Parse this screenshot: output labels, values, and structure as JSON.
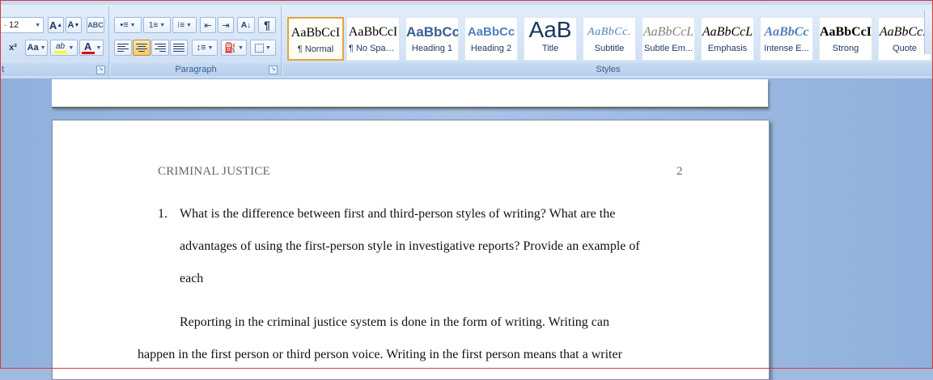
{
  "ribbon": {
    "font_group": {
      "label": "t",
      "font_size": "12",
      "grow_label": "A",
      "shrink_label": "A",
      "superscript_label": "x²",
      "change_case_label": "Aa",
      "highlight_label": "ab",
      "font_color_label": "A",
      "highlight_color": "#ffff00",
      "font_color": "#e00000"
    },
    "paragraph_group": {
      "label": "Paragraph",
      "sort_label": "A↓",
      "show_marks_label": "¶"
    },
    "styles_group": {
      "label": "Styles",
      "styles": [
        {
          "sample": "AaBbCcI",
          "name": "¶ Normal",
          "selected": true
        },
        {
          "sample": "AaBbCcI",
          "name": "¶ No Spaci..."
        },
        {
          "sample": "AaBbCс",
          "name": "Heading 1"
        },
        {
          "sample": "AaBbCc",
          "name": "Heading 2"
        },
        {
          "sample": "AaB",
          "name": "Title"
        },
        {
          "sample": "AaBbCc.",
          "name": "Subtitle"
        },
        {
          "sample": "AaBbCcL",
          "name": "Subtle Em..."
        },
        {
          "sample": "AaBbCcL",
          "name": "Emphasis"
        },
        {
          "sample": "AaBbCc",
          "name": "Intense E..."
        },
        {
          "sample": "AaBbCcI",
          "name": "Strong"
        },
        {
          "sample": "AaBbCcL",
          "name": "Quote"
        }
      ]
    }
  },
  "document": {
    "running_head": "CRIMINAL  JUSTICE",
    "page_number": "2",
    "question_number": "1.",
    "question_lines": [
      "What is the difference between first and third-person styles of writing? What are the",
      "advantages of using the first-person style in investigative reports? Provide an example of",
      "each"
    ],
    "paragraph_lines": [
      "Reporting in the criminal justice system is done in the form of writing. Writing can",
      "happen in the first person or third person voice. Writing in the first person means that a writer"
    ]
  }
}
